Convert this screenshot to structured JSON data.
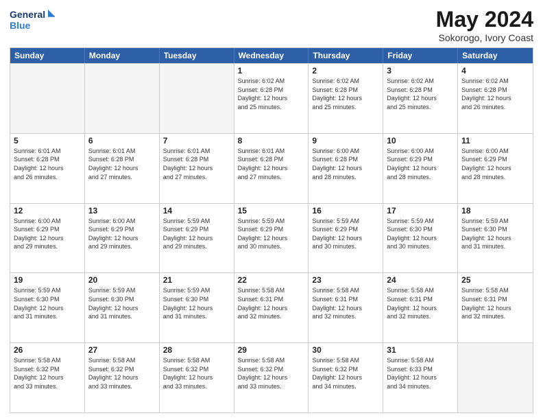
{
  "header": {
    "logo_line1": "General",
    "logo_line2": "Blue",
    "month": "May 2024",
    "location": "Sokorogo, Ivory Coast"
  },
  "weekdays": [
    "Sunday",
    "Monday",
    "Tuesday",
    "Wednesday",
    "Thursday",
    "Friday",
    "Saturday"
  ],
  "rows": [
    [
      {
        "day": "",
        "info": ""
      },
      {
        "day": "",
        "info": ""
      },
      {
        "day": "",
        "info": ""
      },
      {
        "day": "1",
        "info": "Sunrise: 6:02 AM\nSunset: 6:28 PM\nDaylight: 12 hours\nand 25 minutes."
      },
      {
        "day": "2",
        "info": "Sunrise: 6:02 AM\nSunset: 6:28 PM\nDaylight: 12 hours\nand 25 minutes."
      },
      {
        "day": "3",
        "info": "Sunrise: 6:02 AM\nSunset: 6:28 PM\nDaylight: 12 hours\nand 25 minutes."
      },
      {
        "day": "4",
        "info": "Sunrise: 6:02 AM\nSunset: 6:28 PM\nDaylight: 12 hours\nand 26 minutes."
      }
    ],
    [
      {
        "day": "5",
        "info": "Sunrise: 6:01 AM\nSunset: 6:28 PM\nDaylight: 12 hours\nand 26 minutes."
      },
      {
        "day": "6",
        "info": "Sunrise: 6:01 AM\nSunset: 6:28 PM\nDaylight: 12 hours\nand 27 minutes."
      },
      {
        "day": "7",
        "info": "Sunrise: 6:01 AM\nSunset: 6:28 PM\nDaylight: 12 hours\nand 27 minutes."
      },
      {
        "day": "8",
        "info": "Sunrise: 6:01 AM\nSunset: 6:28 PM\nDaylight: 12 hours\nand 27 minutes."
      },
      {
        "day": "9",
        "info": "Sunrise: 6:00 AM\nSunset: 6:28 PM\nDaylight: 12 hours\nand 28 minutes."
      },
      {
        "day": "10",
        "info": "Sunrise: 6:00 AM\nSunset: 6:29 PM\nDaylight: 12 hours\nand 28 minutes."
      },
      {
        "day": "11",
        "info": "Sunrise: 6:00 AM\nSunset: 6:29 PM\nDaylight: 12 hours\nand 28 minutes."
      }
    ],
    [
      {
        "day": "12",
        "info": "Sunrise: 6:00 AM\nSunset: 6:29 PM\nDaylight: 12 hours\nand 29 minutes."
      },
      {
        "day": "13",
        "info": "Sunrise: 6:00 AM\nSunset: 6:29 PM\nDaylight: 12 hours\nand 29 minutes."
      },
      {
        "day": "14",
        "info": "Sunrise: 5:59 AM\nSunset: 6:29 PM\nDaylight: 12 hours\nand 29 minutes."
      },
      {
        "day": "15",
        "info": "Sunrise: 5:59 AM\nSunset: 6:29 PM\nDaylight: 12 hours\nand 30 minutes."
      },
      {
        "day": "16",
        "info": "Sunrise: 5:59 AM\nSunset: 6:29 PM\nDaylight: 12 hours\nand 30 minutes."
      },
      {
        "day": "17",
        "info": "Sunrise: 5:59 AM\nSunset: 6:30 PM\nDaylight: 12 hours\nand 30 minutes."
      },
      {
        "day": "18",
        "info": "Sunrise: 5:59 AM\nSunset: 6:30 PM\nDaylight: 12 hours\nand 31 minutes."
      }
    ],
    [
      {
        "day": "19",
        "info": "Sunrise: 5:59 AM\nSunset: 6:30 PM\nDaylight: 12 hours\nand 31 minutes."
      },
      {
        "day": "20",
        "info": "Sunrise: 5:59 AM\nSunset: 6:30 PM\nDaylight: 12 hours\nand 31 minutes."
      },
      {
        "day": "21",
        "info": "Sunrise: 5:59 AM\nSunset: 6:30 PM\nDaylight: 12 hours\nand 31 minutes."
      },
      {
        "day": "22",
        "info": "Sunrise: 5:58 AM\nSunset: 6:31 PM\nDaylight: 12 hours\nand 32 minutes."
      },
      {
        "day": "23",
        "info": "Sunrise: 5:58 AM\nSunset: 6:31 PM\nDaylight: 12 hours\nand 32 minutes."
      },
      {
        "day": "24",
        "info": "Sunrise: 5:58 AM\nSunset: 6:31 PM\nDaylight: 12 hours\nand 32 minutes."
      },
      {
        "day": "25",
        "info": "Sunrise: 5:58 AM\nSunset: 6:31 PM\nDaylight: 12 hours\nand 32 minutes."
      }
    ],
    [
      {
        "day": "26",
        "info": "Sunrise: 5:58 AM\nSunset: 6:32 PM\nDaylight: 12 hours\nand 33 minutes."
      },
      {
        "day": "27",
        "info": "Sunrise: 5:58 AM\nSunset: 6:32 PM\nDaylight: 12 hours\nand 33 minutes."
      },
      {
        "day": "28",
        "info": "Sunrise: 5:58 AM\nSunset: 6:32 PM\nDaylight: 12 hours\nand 33 minutes."
      },
      {
        "day": "29",
        "info": "Sunrise: 5:58 AM\nSunset: 6:32 PM\nDaylight: 12 hours\nand 33 minutes."
      },
      {
        "day": "30",
        "info": "Sunrise: 5:58 AM\nSunset: 6:32 PM\nDaylight: 12 hours\nand 34 minutes."
      },
      {
        "day": "31",
        "info": "Sunrise: 5:58 AM\nSunset: 6:33 PM\nDaylight: 12 hours\nand 34 minutes."
      },
      {
        "day": "",
        "info": ""
      }
    ]
  ]
}
